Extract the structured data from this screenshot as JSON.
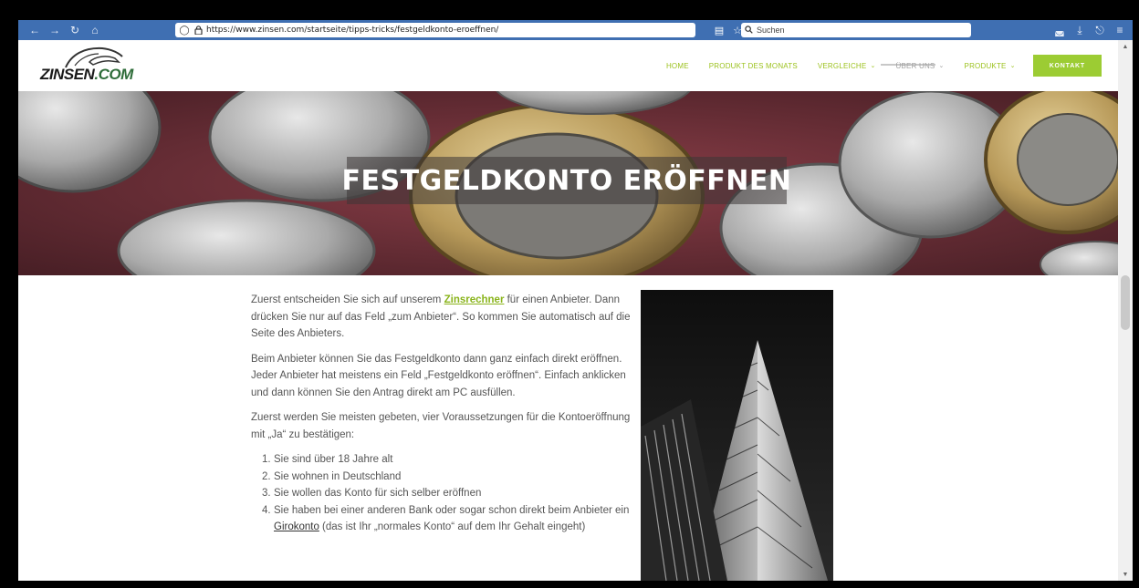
{
  "browser": {
    "url": "https://www.zinsen.com/startseite/tipps-tricks/festgeldkonto-eroeffnen/",
    "search_placeholder": "Suchen",
    "icons": {
      "back": "←",
      "forward": "→",
      "reload": "↻",
      "home": "⌂",
      "shield": "◯",
      "lock": "🔒",
      "reader": "▤",
      "bookmark": "☆",
      "search": "⌕",
      "pocket": "◛",
      "download": "⤓",
      "extensions": "⎋",
      "menu": "≡"
    }
  },
  "site": {
    "logo_text_main": "ZINSEN",
    "logo_text_suffix": ".COM",
    "nav": {
      "home": "HOME",
      "produkt": "PRODUKT DES MONATS",
      "vergleiche": "VERGLEICHE",
      "ueber_uns": "ÜBER UNS",
      "produkte": "PRODUKTE",
      "kontakt": "KONTAKT",
      "chevron": "⌄"
    },
    "colors": {
      "accent_green": "#9ccc33",
      "browser_blue": "#3f6fb2"
    }
  },
  "hero": {
    "title": "FESTGELDKONTO ERÖFFNEN"
  },
  "article": {
    "p1_a": "Zuerst entscheiden Sie sich auf unserem ",
    "p1_link": "Zinsrechner",
    "p1_b": " für einen Anbieter. Dann  drücken Sie nur auf das Feld „zum Anbieter“. So kommen Sie automatisch auf die Seite des Anbieters.",
    "p2": "Beim Anbieter können Sie das Festgeldkonto dann ganz einfach direkt eröffnen. Jeder Anbieter hat meistens ein Feld „Festgeldkonto eröffnen“. Einfach anklicken und dann können Sie den Antrag direkt am PC ausfüllen.",
    "p3": "Zuerst werden Sie meisten gebeten, vier Voraussetzungen für die Kontoeröffnung mit „Ja“ zu bestätigen:",
    "list": [
      {
        "num": "1.",
        "text": "Sie sind über 18 Jahre alt"
      },
      {
        "num": "2.",
        "text": "Sie wohnen in Deutschland"
      },
      {
        "num": "3.",
        "text": "Sie wollen das Konto für sich selber eröffnen"
      }
    ],
    "item4_num": "4.",
    "item4_a": "Sie haben bei einer anderen Bank oder sogar schon direkt beim Anbieter ein ",
    "item4_link": "Girokonto",
    "item4_b": " (das ist Ihr „normales Konto“ auf dem Ihr Gehalt eingeht)"
  },
  "scrollbar": {
    "up": "▲",
    "down": "▼"
  }
}
